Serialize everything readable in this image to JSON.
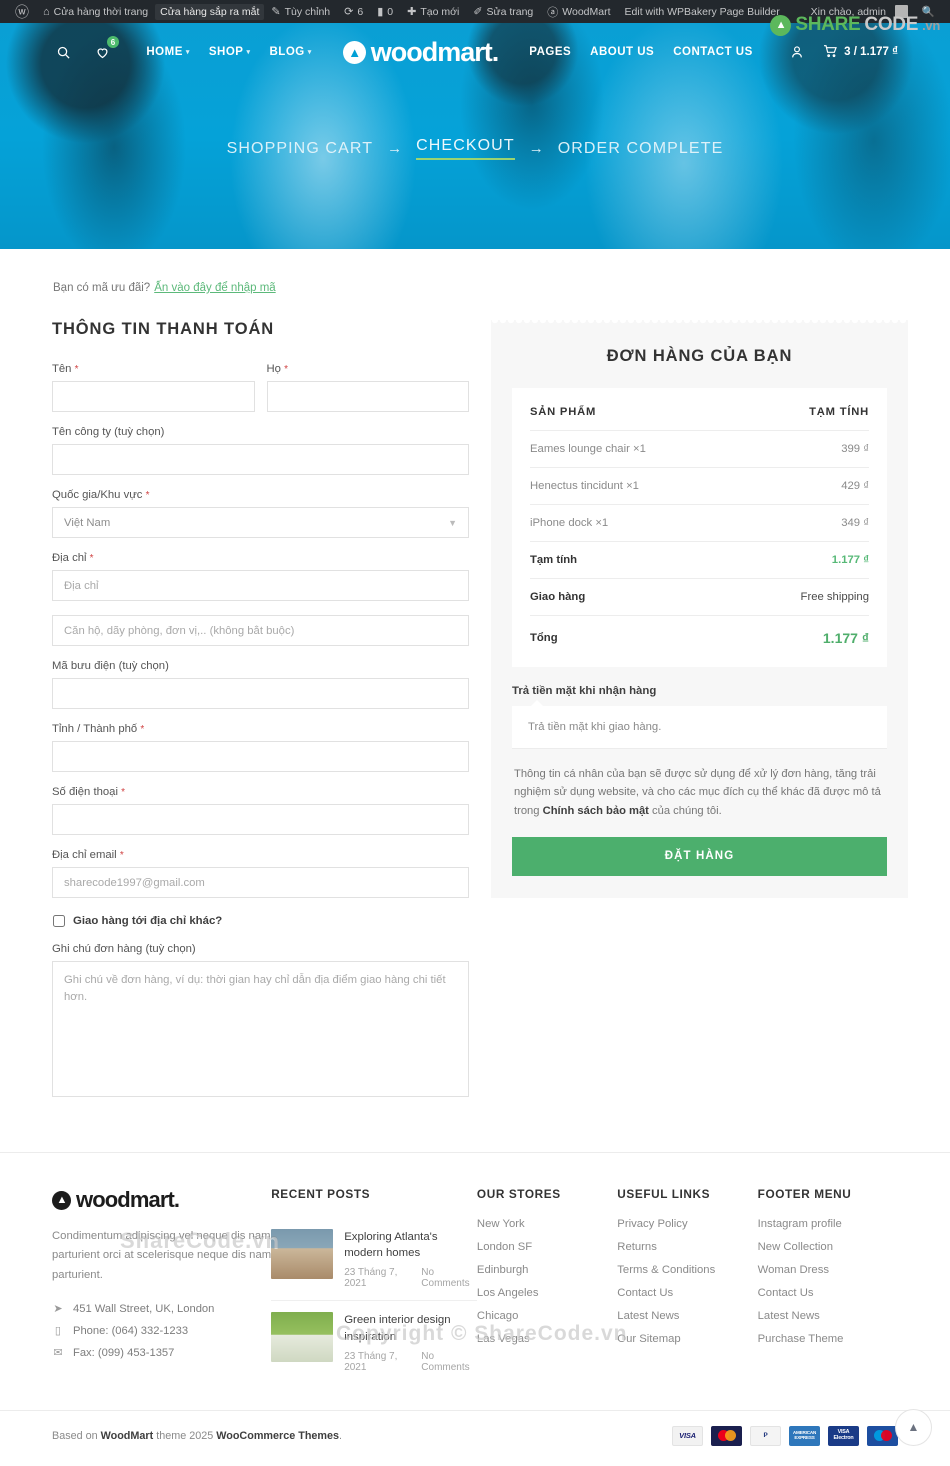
{
  "adminbar": {
    "wp_logo_icon": "wordpress-icon",
    "items": [
      {
        "label": "Cửa hàng thời trang",
        "icon": "home-icon",
        "boxed": false
      },
      {
        "label": "Cửa hàng sắp ra mắt",
        "icon": "",
        "boxed": true
      },
      {
        "label": "Tùy chỉnh",
        "icon": "pencil-icon",
        "boxed": false
      },
      {
        "label": "6",
        "icon": "update-icon",
        "boxed": false
      },
      {
        "label": "0",
        "icon": "comment-icon",
        "boxed": false
      },
      {
        "label": "Tạo mới",
        "icon": "plus-icon",
        "boxed": false
      },
      {
        "label": "Sửa trang",
        "icon": "edit-icon",
        "boxed": false
      },
      {
        "label": "WoodMart",
        "icon": "woodmart-icon",
        "boxed": false
      },
      {
        "label": "Edit with WPBakery Page Builder",
        "icon": "",
        "boxed": false
      }
    ],
    "greeting": "Xin chào, admin",
    "search_icon": "search-icon"
  },
  "header": {
    "brand": "woodmart.",
    "brand_mark_icon": "woodmart-logo-icon",
    "search_icon": "search-icon",
    "wishlist_icon": "heart-icon",
    "wishlist_count": "6",
    "account_icon": "user-icon",
    "cart_icon": "cart-icon",
    "cart_label": "3 / 1.177 ₫",
    "nav_left": [
      {
        "label": "HOME",
        "has_caret": true
      },
      {
        "label": "SHOP",
        "has_caret": true
      },
      {
        "label": "BLOG",
        "has_caret": true
      }
    ],
    "nav_right": [
      {
        "label": "PAGES",
        "has_caret": false
      },
      {
        "label": "ABOUT US",
        "has_caret": false
      },
      {
        "label": "CONTACT US",
        "has_caret": false
      }
    ]
  },
  "steps": {
    "cart": "SHOPPING CART",
    "arrow1": "→",
    "checkout": "CHECKOUT",
    "arrow2": "→",
    "complete": "ORDER COMPLETE"
  },
  "coupon": {
    "text": "Bạn có mã ưu đãi?",
    "link": "Ấn vào đây để nhập mã"
  },
  "billing": {
    "title": "THÔNG TIN THANH TOÁN",
    "first_name_label": "Tên",
    "first_name_value": "",
    "last_name_label": "Họ",
    "last_name_value": "",
    "company_label": "Tên công ty (tuỳ chọn)",
    "company_value": "",
    "country_label": "Quốc gia/Khu vực",
    "country_value": "Việt Nam",
    "address_label": "Địa chỉ",
    "address_placeholder": "Địa chỉ",
    "address2_placeholder": "Căn hộ, dãy phòng, đơn vị,.. (không bắt buộc)",
    "postcode_label": "Mã bưu điện (tuỳ chọn)",
    "postcode_value": "",
    "city_label": "Tỉnh / Thành phố",
    "city_value": "",
    "phone_label": "Số điện thoại",
    "phone_value": "",
    "email_label": "Địa chỉ email",
    "email_placeholder": "sharecode1997@gmail.com",
    "ship_different_label": "Giao hàng tới địa chỉ khác?",
    "ship_different_checked": false,
    "notes_label": "Ghi chú đơn hàng (tuỳ chọn)",
    "notes_placeholder": "Ghi chú về đơn hàng, ví dụ: thời gian hay chỉ dẫn địa điểm giao hàng chi tiết hơn.",
    "required_mark": "*"
  },
  "order": {
    "title": "ĐƠN HÀNG CỦA BẠN",
    "col_product": "SẢN PHẨM",
    "col_subtotal": "TẠM TÍNH",
    "items": [
      {
        "name": "Eames lounge chair ×1",
        "price": "399 ₫"
      },
      {
        "name": "Henectus tincidunt ×1",
        "price": "429 ₫"
      },
      {
        "name": "iPhone dock ×1",
        "price": "349 ₫"
      }
    ],
    "subtotal_label": "Tạm tính",
    "subtotal_value": "1.177 ₫",
    "shipping_label": "Giao hàng",
    "shipping_value": "Free shipping",
    "total_label": "Tổng",
    "total_value": "1.177 ₫",
    "payment_method_label": "Trả tiền mặt khi nhận hàng",
    "payment_method_desc": "Trả tiền mặt khi giao hàng.",
    "privacy_text_1": "Thông tin cá nhân của bạn sẽ được sử dụng để xử lý đơn hàng, tăng trải nghiệm sử dụng website, và cho các mục đích cụ thể khác đã được mô tả trong ",
    "privacy_link": "Chính sách bảo mật",
    "privacy_text_2": " của chúng tôi.",
    "place_order_button": "ĐẶT HÀNG",
    "accent_green": "#4caf6d"
  },
  "footer": {
    "logo": "woodmart.",
    "about": "Condimentum adipiscing vel neque dis nam parturient orci at scelerisque neque dis nam parturient.",
    "contacts": [
      {
        "icon": "location-icon",
        "text": "451 Wall Street, UK, London"
      },
      {
        "icon": "phone-icon",
        "text": "Phone: (064) 332-1233"
      },
      {
        "icon": "mail-icon",
        "text": "Fax: (099) 453-1357"
      }
    ],
    "recent_posts_title": "RECENT POSTS",
    "posts": [
      {
        "title": "Exploring Atlanta's modern homes",
        "date": "23 Tháng 7, 2021",
        "comments": "No Comments"
      },
      {
        "title": "Green interior design inspiration",
        "date": "23 Tháng 7, 2021",
        "comments": "No Comments"
      }
    ],
    "columns": [
      {
        "title": "OUR STORES",
        "links": [
          "New York",
          "London SF",
          "Edinburgh",
          "Los Angeles",
          "Chicago",
          "Las Vegas"
        ]
      },
      {
        "title": "USEFUL LINKS",
        "links": [
          "Privacy Policy",
          "Returns",
          "Terms & Conditions",
          "Contact Us",
          "Latest News",
          "Our Sitemap"
        ]
      },
      {
        "title": "FOOTER MENU",
        "links": [
          "Instagram profile",
          "New Collection",
          "Woman Dress",
          "Contact Us",
          "Latest News",
          "Purchase Theme"
        ]
      }
    ],
    "copyright_pre": "Based on ",
    "copyright_brand": "WoodMart",
    "copyright_mid": " theme 2025 ",
    "copyright_brand2": "WooCommerce Themes",
    "copyright_end": ".",
    "payment_icons": [
      "VISA",
      "MasterCard",
      "PayPal",
      "AMERICAN EXPRESS",
      "VISA Electron",
      "Maestro"
    ],
    "scroll_top_icon": "chevron-up-icon"
  },
  "watermarks": {
    "mid": "ShareCode.vn",
    "low": "Copyright © ShareCode.vn",
    "logo_share": "SHARE",
    "logo_code": "CODE",
    "logo_vn": ".vn"
  }
}
